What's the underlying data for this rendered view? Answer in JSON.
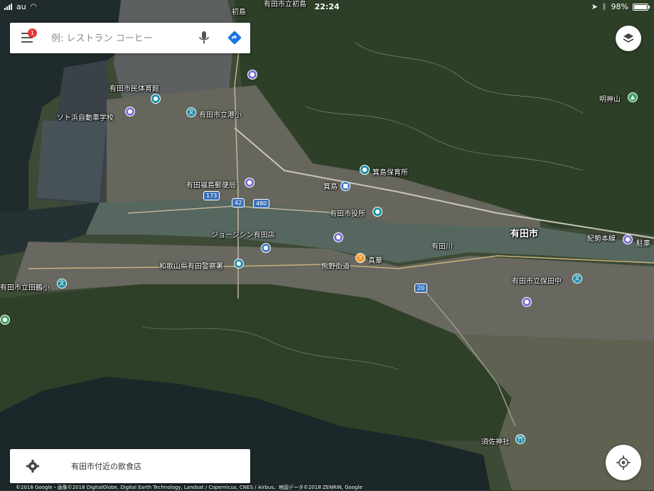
{
  "status_bar": {
    "carrier": "au",
    "time": "22:24",
    "battery": "98%",
    "battery_level": 0.98
  },
  "search": {
    "placeholder": "例: レストラン コーヒー",
    "notification_count": "1"
  },
  "explore": {
    "label": "有田市付近の飲食店"
  },
  "attribution": "©2018 Google・画像©2018 DigitalGlobe, Digital Earth Technology, Landsat / Copernicus, CNES / Airbus、地図データ©2018 ZENRIN, Google",
  "map": {
    "labels": {
      "hatsushima": "初島",
      "arida_gym": "有田市民体育館",
      "soto_school": "ソト浜自動車学校",
      "minato_elem": "有田市立港小",
      "mino_nursery": "箕島保育所",
      "fukushima_post": "有田福島郵便局",
      "minoshima": "箕島",
      "city_hall": "有田市役所",
      "aridashi": "有田市",
      "jusco": "ジョージシン有田店",
      "aridagawa": "有田川",
      "police": "和歌山県有田警察署",
      "kumano_kaido": "熊野街道",
      "shinka": "真華",
      "tazuru": "有田市立田鶴小",
      "hoda_junior": "有田市立保田中",
      "myojinyama": "明神山",
      "kisei_line": "紀勢本線",
      "parking": "駐車",
      "susa_shrine": "須佐神社",
      "top_road": "有田市立初島"
    },
    "routes": {
      "r173": "173",
      "r42": "42",
      "r480": "480",
      "r20": "20"
    },
    "colors": {
      "water": "#2a3a3a",
      "river": "#4a5a52",
      "urban": "#6b6b62",
      "forest": "#2f4028",
      "sea": "#1e2a2c"
    }
  }
}
